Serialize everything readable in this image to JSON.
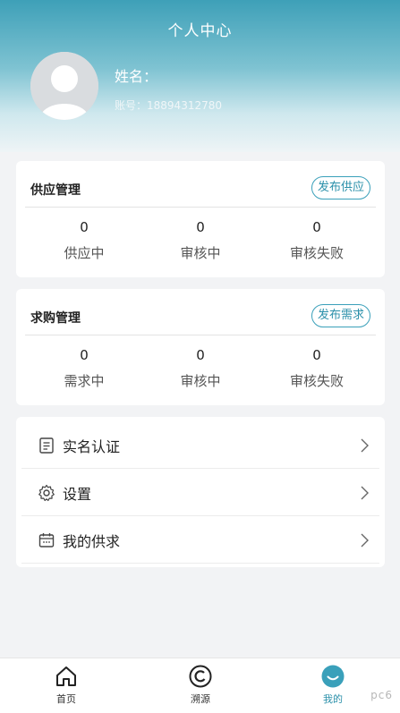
{
  "header": {
    "title": "个人中心",
    "name_label": "姓名：",
    "account_label": "账号：",
    "account_value": "18894312780"
  },
  "supply": {
    "title": "供应管理",
    "action": "发布供应",
    "stats": [
      {
        "value": "0",
        "label": "供应中"
      },
      {
        "value": "0",
        "label": "审核中"
      },
      {
        "value": "0",
        "label": "审核失败"
      }
    ]
  },
  "demand": {
    "title": "求购管理",
    "action": "发布需求",
    "stats": [
      {
        "value": "0",
        "label": "需求中"
      },
      {
        "value": "0",
        "label": "审核中"
      },
      {
        "value": "0",
        "label": "审核失败"
      }
    ]
  },
  "menu": {
    "items": [
      {
        "label": "实名认证",
        "icon": "document-icon"
      },
      {
        "label": "设置",
        "icon": "gear-icon"
      },
      {
        "label": "我的供求",
        "icon": "calendar-icon"
      }
    ]
  },
  "tabbar": {
    "items": [
      {
        "label": "首页",
        "icon": "home-icon"
      },
      {
        "label": "溯源",
        "icon": "trace-icon"
      },
      {
        "label": "我的",
        "icon": "smile-icon",
        "active": true
      }
    ]
  },
  "watermark": "pc6"
}
